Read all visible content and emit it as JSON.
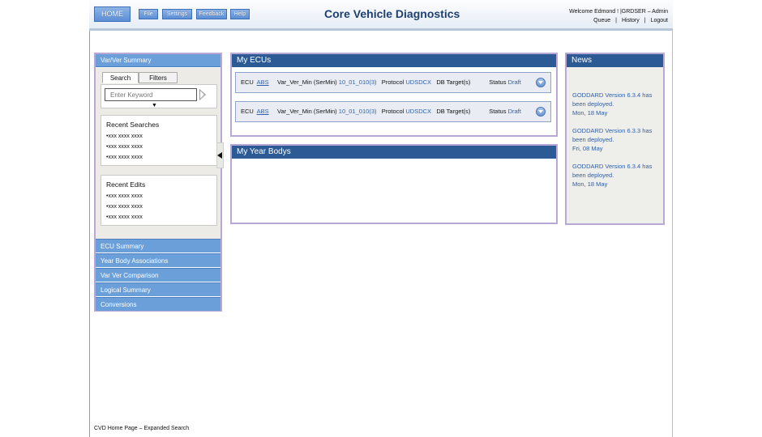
{
  "header": {
    "home_label": "HOME",
    "nav": [
      {
        "label": "File"
      },
      {
        "label": "Settings"
      },
      {
        "label": "Feedback"
      },
      {
        "label": "Help"
      }
    ],
    "app_title": "Core Vehicle Diagnostics",
    "welcome": "Welcome Edmond !  |GRDSER – Admin",
    "links": {
      "queue": "Queue",
      "history": "History",
      "logout": "Logout"
    }
  },
  "sidebar": {
    "title": "Var/Ver Summary",
    "tabs": {
      "search": "Search",
      "filters": "Filters"
    },
    "search": {
      "placeholder": "Enter Keyword"
    },
    "recent_searches": {
      "title": "Recent Searches",
      "items": [
        "•xxx xxxx xxxx",
        "•xxx xxxx xxxx",
        "•xxx xxxx xxxx"
      ]
    },
    "recent_edits": {
      "title": "Recent Edits",
      "items": [
        "•xxx xxxx xxxx",
        "•xxx xxxx xxxx",
        "•xxx xxxx xxxx"
      ]
    },
    "nav": [
      {
        "label": "ECU Summary"
      },
      {
        "label": "Year Body Associations"
      },
      {
        "label": "Var Ver Comparison"
      },
      {
        "label": "Logical Summary"
      },
      {
        "label": "Conversions"
      }
    ]
  },
  "my_ecus": {
    "title": "My ECUs",
    "rows": [
      {
        "ecu_label": "ECU",
        "ecu": "ABS",
        "var_label": "Var_Ver_Min (SerMin)",
        "var": "10_01_010(3)",
        "protocol_label": "Protocol",
        "protocol": "UDSDCX",
        "db_label": "DB Target(s)",
        "status_label": "Status",
        "status": "Draft"
      },
      {
        "ecu_label": "ECU",
        "ecu": "ABS",
        "var_label": "Var_Ver_Min (SerMin)",
        "var": "10_01_010(3)",
        "protocol_label": "Protocol",
        "protocol": "UDSDCX",
        "db_label": "DB Target(s)",
        "status_label": "Status",
        "status": "Draft"
      }
    ]
  },
  "my_year_bodys": {
    "title": "My Year Bodys"
  },
  "news": {
    "title": "News",
    "items": [
      {
        "text": "GODDARD Version 6.3.4 has been deployed.",
        "date": "Mon, 18 May"
      },
      {
        "text": "GODDARD Version 6.3.3 has been deployed.",
        "date": "Fri, 08 May"
      },
      {
        "text": "GODDARD Version 6.3.4 has been deployed.",
        "date": "Mon, 18 May"
      }
    ]
  },
  "footer": "CVD Home Page – Expanded Search"
}
